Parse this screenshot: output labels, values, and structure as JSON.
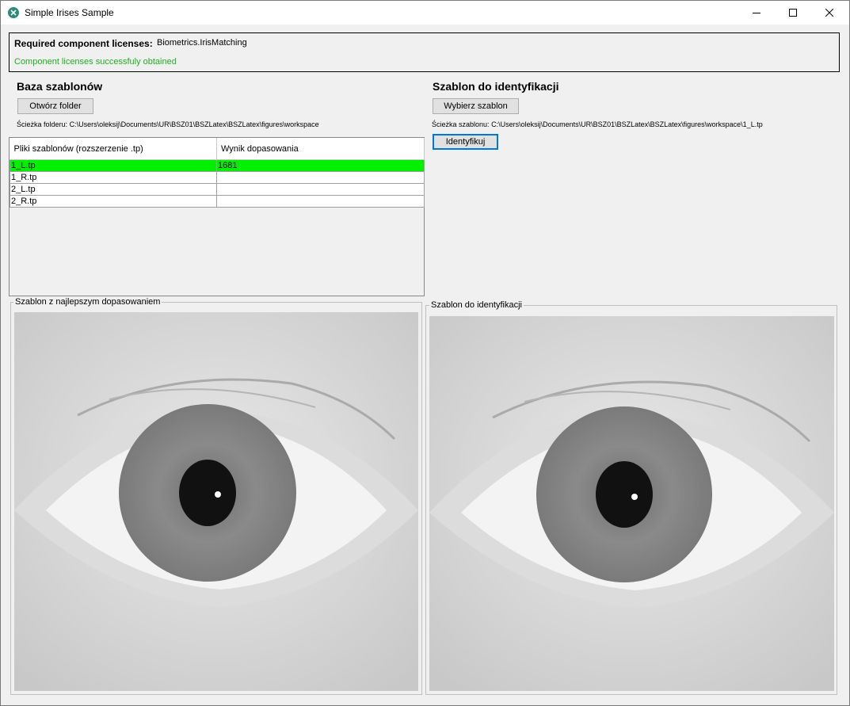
{
  "window": {
    "title": "Simple Irises Sample",
    "icon": "app-icon",
    "controls": [
      "minimize-icon",
      "maximize-icon",
      "close-icon"
    ]
  },
  "licenses": {
    "label": "Required component licenses:",
    "value": "Biometrics.IrisMatching",
    "status": "Component licenses successfuly obtained",
    "status_color": "#20b020"
  },
  "left": {
    "heading": "Baza szablonów",
    "open_folder_label": "Otwórz folder",
    "path_label": "Ścieżka folderu:",
    "path_value": "C:\\Users\\oleksij\\Documents\\UR\\BSZ01\\BSZLatex\\BSZLatex\\figures\\workspace",
    "table": {
      "columns": [
        "Pliki szablonów (rozszerzenie .tp)",
        "Wynik dopasowania"
      ],
      "rows": [
        {
          "file": "1_L.tp",
          "score": "1681",
          "selected": true
        },
        {
          "file": "1_R.tp",
          "score": "",
          "selected": false
        },
        {
          "file": "2_L.tp",
          "score": "",
          "selected": false
        },
        {
          "file": "2_R.tp",
          "score": "",
          "selected": false
        }
      ],
      "highlight_color": "#00f000"
    },
    "best_match_group": "Szablon z najlepszym dopasowaniem"
  },
  "right": {
    "heading": "Szablon do identyfikacji",
    "choose_label": "Wybierz szablon",
    "path_label": "Ścieżka szablonu:",
    "path_value": "C:\\Users\\oleksij\\Documents\\UR\\BSZ01\\BSZLatex\\BSZLatex\\figures\\workspace\\1_L.tp",
    "identify_label": "Identyfikuj",
    "identify_group": "Szablon do identyfikacji"
  }
}
